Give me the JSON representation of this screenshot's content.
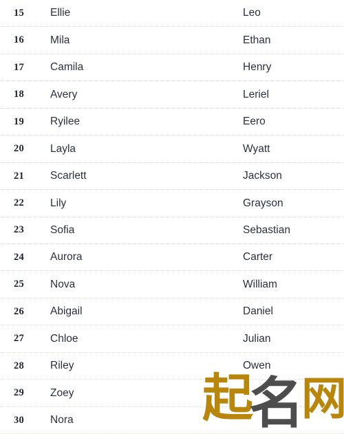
{
  "table": {
    "columns": [
      "rank",
      "girl_name",
      "boy_name"
    ],
    "rows": [
      {
        "rank": "15",
        "girl": "Ellie",
        "boy": "Leo"
      },
      {
        "rank": "16",
        "girl": "Mila",
        "boy": "Ethan"
      },
      {
        "rank": "17",
        "girl": "Camila",
        "boy": "Henry"
      },
      {
        "rank": "18",
        "girl": "Avery",
        "boy": "Leriel"
      },
      {
        "rank": "19",
        "girl": "Ryilee",
        "boy": "Eero"
      },
      {
        "rank": "20",
        "girl": "Layla",
        "boy": "Wyatt"
      },
      {
        "rank": "21",
        "girl": "Scarlett",
        "boy": "Jackson"
      },
      {
        "rank": "22",
        "girl": "Lily",
        "boy": "Grayson"
      },
      {
        "rank": "23",
        "girl": "Sofia",
        "boy": "Sebastian"
      },
      {
        "rank": "24",
        "girl": "Aurora",
        "boy": "Carter"
      },
      {
        "rank": "25",
        "girl": "Nova",
        "boy": "William"
      },
      {
        "rank": "26",
        "girl": "Abigail",
        "boy": "Daniel"
      },
      {
        "rank": "27",
        "girl": "Chloe",
        "boy": "Julian"
      },
      {
        "rank": "28",
        "girl": "Riley",
        "boy": "Owen"
      },
      {
        "rank": "29",
        "girl": "Zoey",
        "boy": ""
      },
      {
        "rank": "30",
        "girl": "Nora",
        "boy": ""
      }
    ]
  },
  "watermark": {
    "text": "起名网",
    "char1": "起",
    "char2": "名",
    "char3": "网",
    "color_gold": "#b8860b",
    "color_gray": "#4d4d4d"
  },
  "colors": {
    "text": "#2b303c",
    "rank_text": "#20242e",
    "divider": "#e6e4df",
    "background": "#ffffff"
  }
}
